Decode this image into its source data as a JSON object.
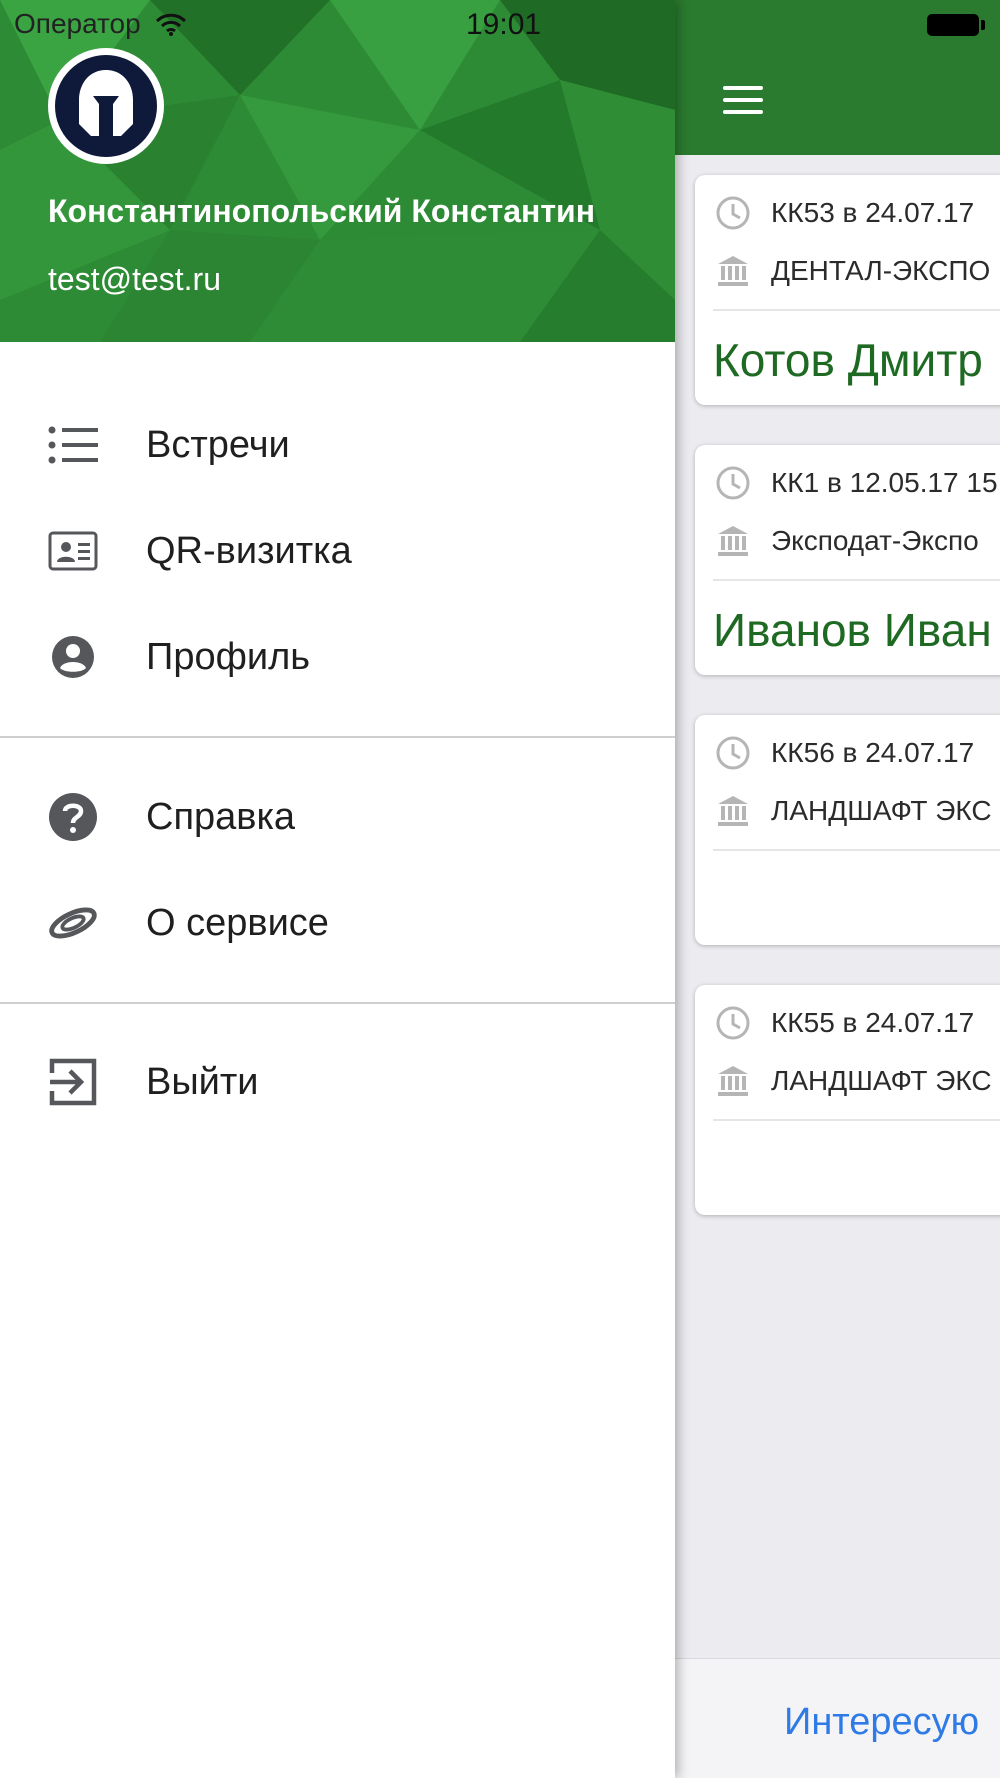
{
  "status_bar": {
    "carrier": "Оператор",
    "time": "19:01"
  },
  "drawer": {
    "user": {
      "name": "Константинопольский Константин",
      "email": "test@test.ru"
    },
    "menu": [
      {
        "label": "Встречи",
        "icon": "list-icon"
      },
      {
        "label": "QR-визитка",
        "icon": "contact-card-icon"
      },
      {
        "label": "Профиль",
        "icon": "account-circle-icon"
      },
      {
        "label": "Справка",
        "icon": "help-circle-icon"
      },
      {
        "label": "О сервисе",
        "icon": "service-logo-icon"
      },
      {
        "label": "Выйти",
        "icon": "logout-icon"
      }
    ]
  },
  "main": {
    "cards": [
      {
        "meta": "КК53 в 24.07.17",
        "venue": "ДЕНТАЛ-ЭКСПО",
        "person": "Котов Дмитр"
      },
      {
        "meta": "КК1 в 12.05.17 15",
        "venue": "Эксподат-Экспо",
        "person": "Иванов Иван"
      },
      {
        "meta": "КК56 в 24.07.17",
        "venue": "ЛАНДШАФТ ЭКС",
        "person": ""
      },
      {
        "meta": "КК55 в 24.07.17",
        "venue": "ЛАНДШАФТ ЭКС",
        "person": ""
      }
    ],
    "bottom_link": "Интересую"
  },
  "colors": {
    "header_green": "#2d8a34",
    "appbar_green": "#2a7a2f",
    "name_green": "#1f6a23",
    "link_blue": "#2e7ae6"
  }
}
